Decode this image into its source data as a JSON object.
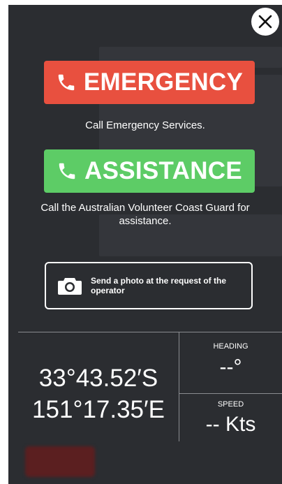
{
  "close": {
    "icon": "close-icon"
  },
  "emergency": {
    "label": "EMERGENCY",
    "icon": "phone-icon",
    "color": "#e8503f",
    "caption": "Call Emergency Services."
  },
  "assistance": {
    "label": "ASSISTANCE",
    "icon": "phone-icon",
    "color": "#5dcc66",
    "caption": "Call the Australian Volunteer Coast Guard for assistance."
  },
  "photo": {
    "icon": "camera-icon",
    "label": "Send a photo at the request of the operator"
  },
  "position": {
    "latitude": "33°43.52′S",
    "longitude": "151°17.35′E"
  },
  "heading": {
    "label": "HEADING",
    "value": "--°"
  },
  "speed": {
    "label": "SPEED",
    "value": "-- Kts"
  }
}
